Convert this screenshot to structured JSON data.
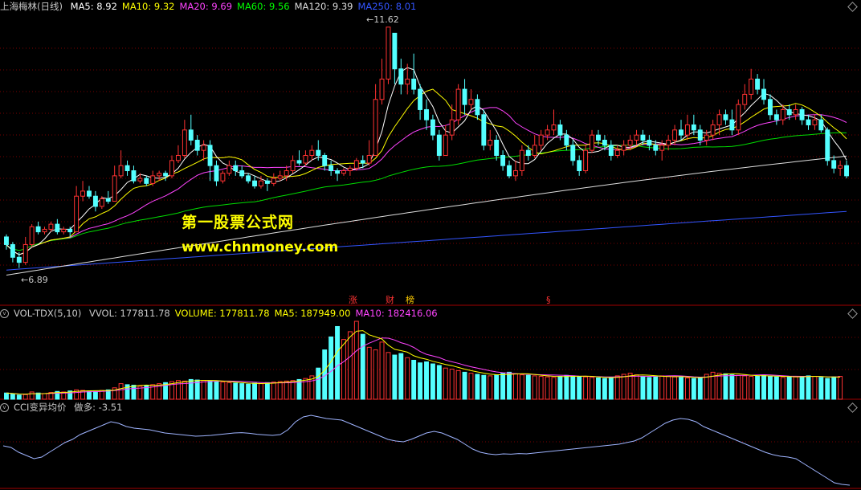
{
  "header": {
    "stock_name": "上海梅林(日线)",
    "ma": [
      {
        "label": "MA5: 8.92",
        "color": "#ffffff"
      },
      {
        "label": "MA10: 9.32",
        "color": "#ffff00"
      },
      {
        "label": "MA20: 9.69",
        "color": "#ff44ff"
      },
      {
        "label": "MA60: 9.56",
        "color": "#00ff00"
      },
      {
        "label": "MA120: 9.39",
        "color": "#dddddd"
      },
      {
        "label": "MA250: 8.01",
        "color": "#3355ff"
      }
    ]
  },
  "watermark": {
    "line1": "第一股票公式网",
    "line2": "www.chnmoney.com"
  },
  "price_labels": {
    "high": "11.62",
    "low": "6.89"
  },
  "events": [
    {
      "label": "涨",
      "color": "#ff3333"
    },
    {
      "label": "财",
      "color": "#ff3333"
    },
    {
      "label": "榜",
      "color": "#ffcc00"
    },
    {
      "label": "§",
      "color": "#ff3333"
    }
  ],
  "volume_panel": {
    "title": "VOL-TDX(5,10)",
    "items": [
      {
        "label": "VVOL: 177811.78",
        "color": "#c8c8c8"
      },
      {
        "label": "VOLUME: 177811.78",
        "color": "#ffff00"
      },
      {
        "label": "MA5: 187949.00",
        "color": "#ffff00"
      },
      {
        "label": "MA10: 182416.06",
        "color": "#ff44ff"
      }
    ]
  },
  "cci_panel": {
    "title": "CCI变异均价",
    "item": "做多: -3.51"
  },
  "chart_data": {
    "type": "candlestick",
    "price_range": [
      6.6,
      11.9
    ],
    "candles": [
      [
        7.5,
        7.35,
        7.55,
        7.25
      ],
      [
        7.35,
        7.1,
        7.4,
        7.0
      ],
      [
        7.1,
        7.0,
        7.2,
        6.89
      ],
      [
        7.0,
        7.35,
        7.5,
        6.95
      ],
      [
        7.35,
        7.7,
        7.75,
        7.3
      ],
      [
        7.7,
        7.6,
        7.8,
        7.55
      ],
      [
        7.6,
        7.65,
        7.7,
        7.55
      ],
      [
        7.65,
        7.75,
        7.8,
        7.6
      ],
      [
        7.75,
        7.6,
        7.85,
        7.55
      ],
      [
        7.6,
        7.65,
        7.7,
        7.55
      ],
      [
        7.65,
        7.6,
        7.7,
        7.5
      ],
      [
        7.6,
        8.3,
        8.5,
        7.6
      ],
      [
        8.3,
        8.4,
        8.6,
        8.2
      ],
      [
        8.4,
        8.3,
        8.5,
        8.25
      ],
      [
        8.3,
        8.1,
        8.4,
        8.0
      ],
      [
        8.1,
        8.25,
        8.3,
        8.05
      ],
      [
        8.25,
        8.2,
        8.4,
        8.15
      ],
      [
        8.2,
        8.7,
        8.9,
        8.2
      ],
      [
        8.7,
        8.9,
        9.2,
        8.65
      ],
      [
        8.9,
        8.8,
        9.0,
        8.7
      ],
      [
        8.8,
        8.6,
        8.9,
        8.55
      ],
      [
        8.6,
        8.65,
        8.75,
        8.55
      ],
      [
        8.65,
        8.55,
        8.7,
        8.5
      ],
      [
        8.55,
        8.7,
        8.8,
        8.5
      ],
      [
        8.7,
        8.75,
        8.8,
        8.6
      ],
      [
        8.75,
        8.7,
        8.8,
        8.6
      ],
      [
        8.7,
        9.0,
        9.1,
        8.65
      ],
      [
        9.0,
        9.1,
        9.3,
        8.95
      ],
      [
        9.1,
        9.6,
        9.8,
        9.05
      ],
      [
        9.6,
        9.4,
        9.9,
        9.3
      ],
      [
        9.4,
        9.2,
        9.5,
        9.1
      ],
      [
        9.2,
        9.3,
        9.4,
        9.0
      ],
      [
        9.3,
        8.9,
        9.4,
        8.6
      ],
      [
        8.9,
        8.6,
        9.0,
        8.5
      ],
      [
        8.6,
        8.75,
        8.8,
        8.55
      ],
      [
        8.75,
        8.9,
        9.0,
        8.7
      ],
      [
        8.9,
        8.8,
        9.0,
        8.7
      ],
      [
        8.8,
        8.7,
        8.9,
        8.65
      ],
      [
        8.7,
        8.6,
        8.75,
        8.55
      ],
      [
        8.6,
        8.5,
        8.7,
        8.45
      ],
      [
        8.5,
        8.6,
        8.7,
        8.45
      ],
      [
        8.6,
        8.55,
        8.65,
        8.4
      ],
      [
        8.55,
        8.65,
        8.75,
        8.5
      ],
      [
        8.65,
        8.7,
        8.8,
        8.6
      ],
      [
        8.7,
        8.8,
        8.9,
        8.6
      ],
      [
        8.8,
        9.0,
        9.1,
        8.75
      ],
      [
        9.0,
        8.95,
        9.2,
        8.9
      ],
      [
        8.95,
        9.1,
        9.2,
        8.9
      ],
      [
        9.1,
        9.2,
        9.3,
        9.0
      ],
      [
        9.2,
        9.1,
        9.4,
        9.0
      ],
      [
        9.1,
        8.9,
        9.15,
        8.8
      ],
      [
        8.9,
        8.8,
        9.0,
        8.7
      ],
      [
        8.8,
        8.75,
        8.85,
        8.6
      ],
      [
        8.75,
        8.8,
        8.85,
        8.7
      ],
      [
        8.8,
        8.85,
        8.9,
        8.7
      ],
      [
        8.85,
        9.0,
        9.05,
        8.8
      ],
      [
        9.0,
        8.95,
        9.1,
        8.85
      ],
      [
        8.95,
        9.1,
        9.4,
        8.9
      ],
      [
        9.1,
        10.2,
        10.5,
        9.1
      ],
      [
        10.2,
        10.6,
        11.0,
        10.1
      ],
      [
        10.6,
        11.62,
        11.62,
        10.5
      ],
      [
        11.5,
        10.8,
        11.5,
        10.5
      ],
      [
        10.8,
        10.5,
        11.0,
        10.3
      ],
      [
        10.5,
        10.6,
        10.9,
        10.3
      ],
      [
        10.6,
        10.4,
        11.1,
        10.3
      ],
      [
        10.4,
        10.0,
        10.5,
        9.8
      ],
      [
        10.0,
        9.8,
        10.2,
        9.6
      ],
      [
        9.8,
        9.5,
        9.9,
        9.4
      ],
      [
        9.5,
        9.1,
        9.6,
        9.0
      ],
      [
        9.1,
        9.5,
        9.7,
        9.1
      ],
      [
        9.5,
        9.8,
        10.1,
        9.4
      ],
      [
        9.8,
        10.4,
        10.5,
        9.7
      ],
      [
        10.4,
        10.1,
        10.6,
        9.9
      ],
      [
        10.1,
        10.2,
        10.4,
        10.0
      ],
      [
        10.2,
        9.9,
        10.3,
        9.8
      ],
      [
        9.9,
        9.3,
        10.0,
        9.2
      ],
      [
        9.3,
        9.4,
        9.6,
        9.2
      ],
      [
        9.4,
        9.1,
        9.5,
        9.0
      ],
      [
        9.1,
        8.9,
        9.2,
        8.8
      ],
      [
        8.9,
        8.7,
        9.0,
        8.65
      ],
      [
        8.7,
        8.8,
        9.0,
        8.6
      ],
      [
        8.8,
        9.2,
        9.3,
        8.7
      ],
      [
        9.2,
        9.1,
        9.3,
        9.0
      ],
      [
        9.1,
        9.3,
        9.5,
        9.05
      ],
      [
        9.3,
        9.5,
        9.6,
        9.2
      ],
      [
        9.5,
        9.6,
        9.7,
        9.4
      ],
      [
        9.6,
        9.7,
        10.0,
        9.5
      ],
      [
        9.7,
        9.5,
        9.8,
        9.4
      ],
      [
        9.5,
        9.3,
        9.6,
        9.2
      ],
      [
        9.3,
        9.0,
        9.4,
        8.9
      ],
      [
        9.0,
        8.8,
        9.1,
        8.7
      ],
      [
        8.8,
        9.2,
        9.3,
        8.75
      ],
      [
        9.2,
        9.5,
        9.6,
        9.15
      ],
      [
        9.5,
        9.4,
        9.6,
        9.3
      ],
      [
        9.4,
        9.3,
        9.5,
        9.2
      ],
      [
        9.3,
        9.1,
        9.4,
        9.0
      ],
      [
        9.1,
        9.2,
        9.3,
        9.05
      ],
      [
        9.2,
        9.3,
        9.4,
        9.1
      ],
      [
        9.3,
        9.4,
        9.5,
        9.2
      ],
      [
        9.4,
        9.5,
        9.6,
        9.3
      ],
      [
        9.5,
        9.4,
        9.6,
        9.3
      ],
      [
        9.4,
        9.3,
        9.5,
        9.2
      ],
      [
        9.3,
        9.2,
        9.4,
        9.1
      ],
      [
        9.2,
        9.3,
        9.4,
        9.0
      ],
      [
        9.3,
        9.4,
        9.5,
        9.2
      ],
      [
        9.4,
        9.6,
        9.7,
        9.3
      ],
      [
        9.6,
        9.5,
        9.8,
        9.4
      ],
      [
        9.5,
        9.7,
        9.9,
        9.4
      ],
      [
        9.7,
        9.6,
        9.9,
        9.5
      ],
      [
        9.6,
        9.4,
        9.7,
        9.3
      ],
      [
        9.4,
        9.5,
        9.6,
        9.3
      ],
      [
        9.5,
        9.7,
        9.8,
        9.4
      ],
      [
        9.7,
        9.9,
        10.0,
        9.5
      ],
      [
        9.9,
        9.8,
        10.0,
        9.7
      ],
      [
        9.8,
        9.6,
        10.0,
        9.5
      ],
      [
        9.6,
        10.1,
        10.2,
        9.5
      ],
      [
        10.1,
        10.3,
        10.5,
        10.0
      ],
      [
        10.3,
        10.6,
        10.8,
        10.2
      ],
      [
        10.6,
        10.4,
        10.7,
        10.3
      ],
      [
        10.4,
        10.2,
        10.6,
        10.1
      ],
      [
        10.2,
        9.9,
        10.3,
        9.8
      ],
      [
        9.9,
        9.8,
        10.0,
        9.7
      ],
      [
        9.8,
        10.0,
        10.1,
        9.7
      ],
      [
        10.0,
        9.9,
        10.1,
        9.8
      ],
      [
        9.9,
        10.0,
        10.1,
        9.8
      ],
      [
        10.0,
        9.8,
        10.05,
        9.7
      ],
      [
        9.8,
        9.7,
        9.9,
        9.6
      ],
      [
        9.7,
        9.8,
        9.9,
        9.6
      ],
      [
        9.8,
        9.6,
        9.9,
        9.55
      ],
      [
        9.6,
        9.0,
        9.65,
        8.9
      ],
      [
        9.0,
        8.85,
        9.1,
        8.75
      ],
      [
        8.85,
        8.9,
        9.0,
        8.7
      ],
      [
        8.9,
        8.7,
        9.0,
        8.65
      ]
    ],
    "volumes": [
      12,
      10,
      8,
      9,
      14,
      12,
      11,
      13,
      15,
      14,
      16,
      18,
      17,
      16,
      15,
      17,
      18,
      22,
      30,
      28,
      27,
      25,
      26,
      28,
      30,
      32,
      34,
      36,
      35,
      38,
      37,
      36,
      35,
      34,
      33,
      32,
      31,
      30,
      29,
      31,
      30,
      32,
      33,
      34,
      35,
      36,
      38,
      40,
      45,
      60,
      95,
      120,
      140,
      115,
      130,
      150,
      125,
      100,
      95,
      110,
      90,
      85,
      88,
      80,
      75,
      70,
      72,
      68,
      65,
      60,
      58,
      55,
      52,
      50,
      48,
      46,
      45,
      47,
      50,
      52,
      49,
      47,
      46,
      45,
      44,
      43,
      42,
      44,
      46,
      45,
      44,
      43,
      42,
      41,
      40,
      42,
      45,
      48,
      50,
      47,
      44,
      42,
      43,
      45,
      44,
      43,
      42,
      41,
      40,
      42,
      48,
      52,
      50,
      49,
      47,
      46,
      45,
      44,
      45,
      46,
      44,
      43,
      42,
      44,
      43,
      44,
      45,
      44,
      42,
      40,
      43,
      44
    ],
    "cci": [
      -20,
      -30,
      -60,
      -80,
      -100,
      -90,
      -60,
      -30,
      0,
      20,
      50,
      70,
      90,
      110,
      130,
      120,
      100,
      90,
      85,
      80,
      70,
      60,
      55,
      50,
      45,
      40,
      42,
      45,
      50,
      55,
      60,
      62,
      58,
      52,
      48,
      45,
      50,
      80,
      130,
      160,
      170,
      160,
      150,
      145,
      140,
      120,
      100,
      80,
      60,
      40,
      20,
      10,
      5,
      20,
      40,
      60,
      70,
      60,
      40,
      20,
      -10,
      -40,
      -60,
      -70,
      -75,
      -70,
      -72,
      -68,
      -70,
      -65,
      -60,
      -55,
      -50,
      -45,
      -40,
      -35,
      -30,
      -25,
      -20,
      -15,
      -10,
      0,
      10,
      30,
      60,
      90,
      120,
      140,
      150,
      145,
      130,
      100,
      80,
      60,
      40,
      20,
      0,
      -20,
      -40,
      -60,
      -75,
      -85,
      -90,
      -100,
      -130,
      -160,
      -190,
      -220,
      -250,
      -260,
      -265
    ]
  }
}
